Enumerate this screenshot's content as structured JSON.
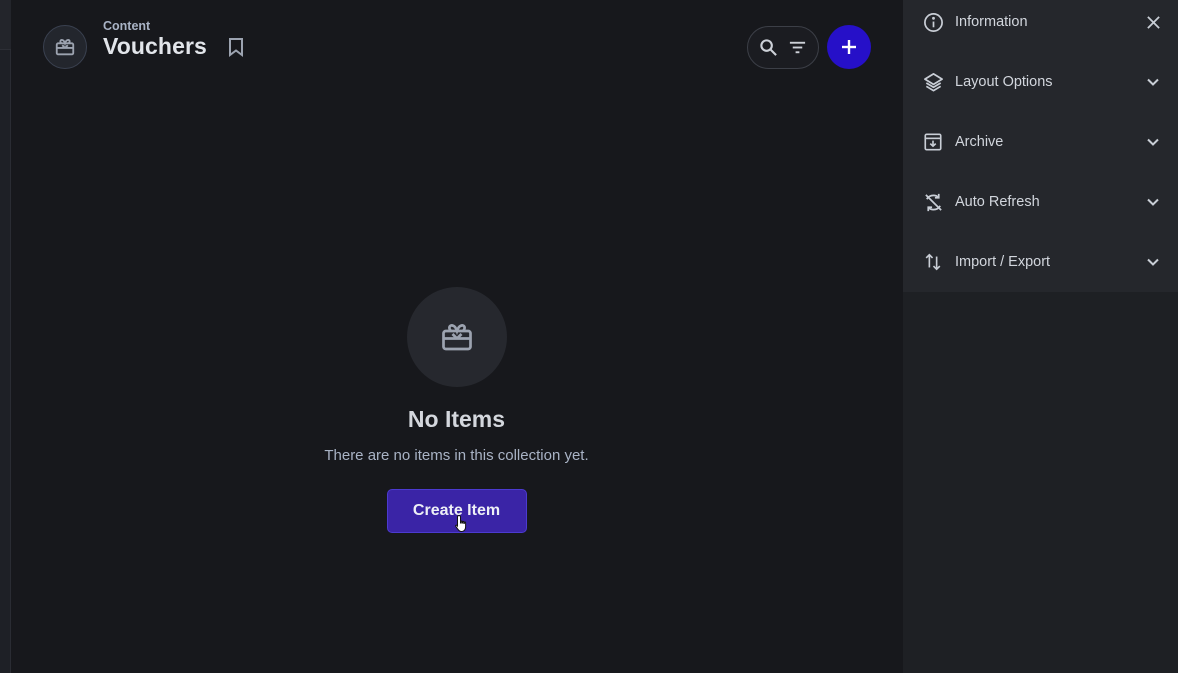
{
  "header": {
    "breadcrumb": "Content",
    "title": "Vouchers",
    "icons": {
      "collection": "redeem-icon",
      "bookmark": "bookmark-icon",
      "search": "search-icon",
      "filter": "filter-icon",
      "add": "plus-icon"
    }
  },
  "empty_state": {
    "icon": "redeem-icon",
    "title": "No Items",
    "message": "There are no items in this collection yet.",
    "create_label": "Create Item"
  },
  "sidebar": {
    "items": [
      {
        "label": "Information",
        "icon": "info-icon",
        "action_icon": "close-icon"
      },
      {
        "label": "Layout Options",
        "icon": "layers-icon",
        "action_icon": "chevron-down-icon"
      },
      {
        "label": "Archive",
        "icon": "archive-icon",
        "action_icon": "chevron-down-icon"
      },
      {
        "label": "Auto Refresh",
        "icon": "sync-disabled-icon",
        "action_icon": "chevron-down-icon"
      },
      {
        "label": "Import / Export",
        "icon": "import-export-icon",
        "action_icon": "chevron-down-icon"
      }
    ]
  },
  "colors": {
    "background": "#17181c",
    "sidebar": "#25272c",
    "accent": "#2610c8",
    "button": "#3a24a6",
    "muted_text": "#a9b3c5"
  }
}
